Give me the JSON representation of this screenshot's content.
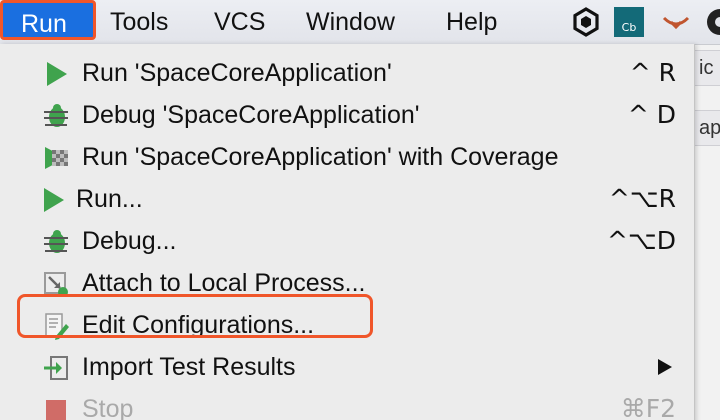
{
  "menubar": {
    "items": [
      "Run",
      "Tools",
      "VCS",
      "Window",
      "Help"
    ],
    "tray_icons": [
      "jetbrains-toolbox-icon",
      "cb-icon",
      "wifi-icon",
      "chrome-icon"
    ],
    "tray_cb_label": "Cb"
  },
  "editor_peek": {
    "tab_top": "ic",
    "tab_bottom": "ap"
  },
  "run_menu": {
    "items": [
      {
        "label": "Run 'SpaceCoreApplication'",
        "shortcut": "^ R",
        "icon": "run-icon"
      },
      {
        "label": "Debug 'SpaceCoreApplication'",
        "shortcut": "^ D",
        "icon": "debug-icon"
      },
      {
        "label": "Run 'SpaceCoreApplication' with Coverage",
        "shortcut": "",
        "icon": "coverage-icon"
      },
      {
        "label": "Run...",
        "shortcut": "^⌥R",
        "icon": "run-icon"
      },
      {
        "label": "Debug...",
        "shortcut": "^⌥D",
        "icon": "debug-icon"
      },
      {
        "label": "Attach to Local Process...",
        "shortcut": "",
        "icon": "attach-process-icon"
      },
      {
        "label": "Edit Configurations...",
        "shortcut": "",
        "icon": "edit-config-icon"
      },
      {
        "label": "Import Test Results",
        "shortcut": "",
        "icon": "import-icon",
        "submenu": true
      },
      {
        "label": "Stop",
        "shortcut": "⌘F2",
        "icon": "stop-icon",
        "disabled": true
      }
    ]
  },
  "colors": {
    "menubar_active": "#1a6fe0",
    "highlight_outline": "#f0562a",
    "run_green": "#3fa34d",
    "stop_red": "#c7423b"
  }
}
